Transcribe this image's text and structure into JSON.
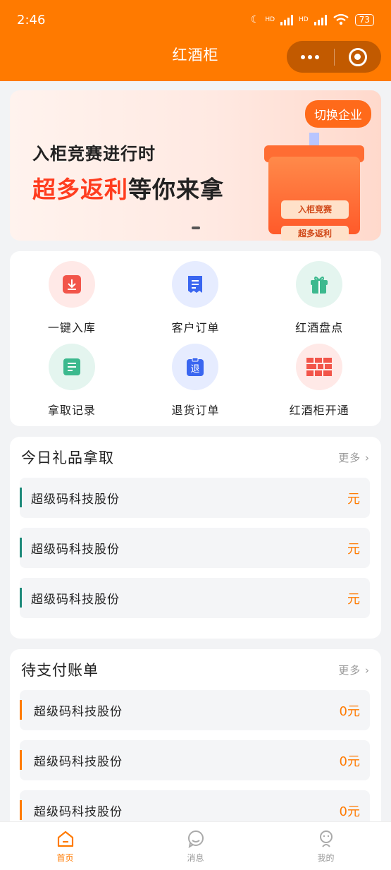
{
  "status_bar": {
    "time": "2:46",
    "network_1": "HD",
    "network_2": "HD",
    "battery": "73"
  },
  "header": {
    "title": "红酒柜"
  },
  "banner": {
    "line1": "入柜竞赛进行时",
    "line2_highlight": "超多返利",
    "line2_rest": "等你来拿",
    "switch_label": "切换企业",
    "gift_tag_1": "入柜竞赛",
    "gift_tag_2": "超多返利"
  },
  "quick_actions": [
    {
      "label": "一键入库",
      "icon": "download-icon"
    },
    {
      "label": "客户订单",
      "icon": "receipt-icon"
    },
    {
      "label": "红酒盘点",
      "icon": "gift-icon"
    },
    {
      "label": "拿取记录",
      "icon": "list-icon"
    },
    {
      "label": "退货订单",
      "icon": "return-icon",
      "glyph": "退"
    },
    {
      "label": "红酒柜开通",
      "icon": "cabinet-grid-icon"
    }
  ],
  "gift_section": {
    "title": "今日礼品拿取",
    "more": "更多",
    "rows": [
      {
        "name": "超级码科技股份",
        "amount": "元"
      },
      {
        "name": "超级码科技股份",
        "amount": "元"
      },
      {
        "name": "超级码科技股份",
        "amount": "元"
      }
    ]
  },
  "bill_section": {
    "title": "待支付账单",
    "more": "更多",
    "rows": [
      {
        "name": "超级码科技股份",
        "amount": "0元"
      },
      {
        "name": "超级码科技股份",
        "amount": "0元"
      },
      {
        "name": "超级码科技股份",
        "amount": "0元"
      }
    ]
  },
  "tabbar": [
    {
      "label": "首页",
      "icon": "home-icon",
      "active": true
    },
    {
      "label": "消息",
      "icon": "message-icon",
      "active": false
    },
    {
      "label": "我的",
      "icon": "profile-icon",
      "active": false
    }
  ],
  "colors": {
    "brand": "#ff7a00",
    "gift_accent": "#1e8a7a",
    "bill_accent": "#ff7a00",
    "banner_highlight": "#ff3d1f"
  }
}
